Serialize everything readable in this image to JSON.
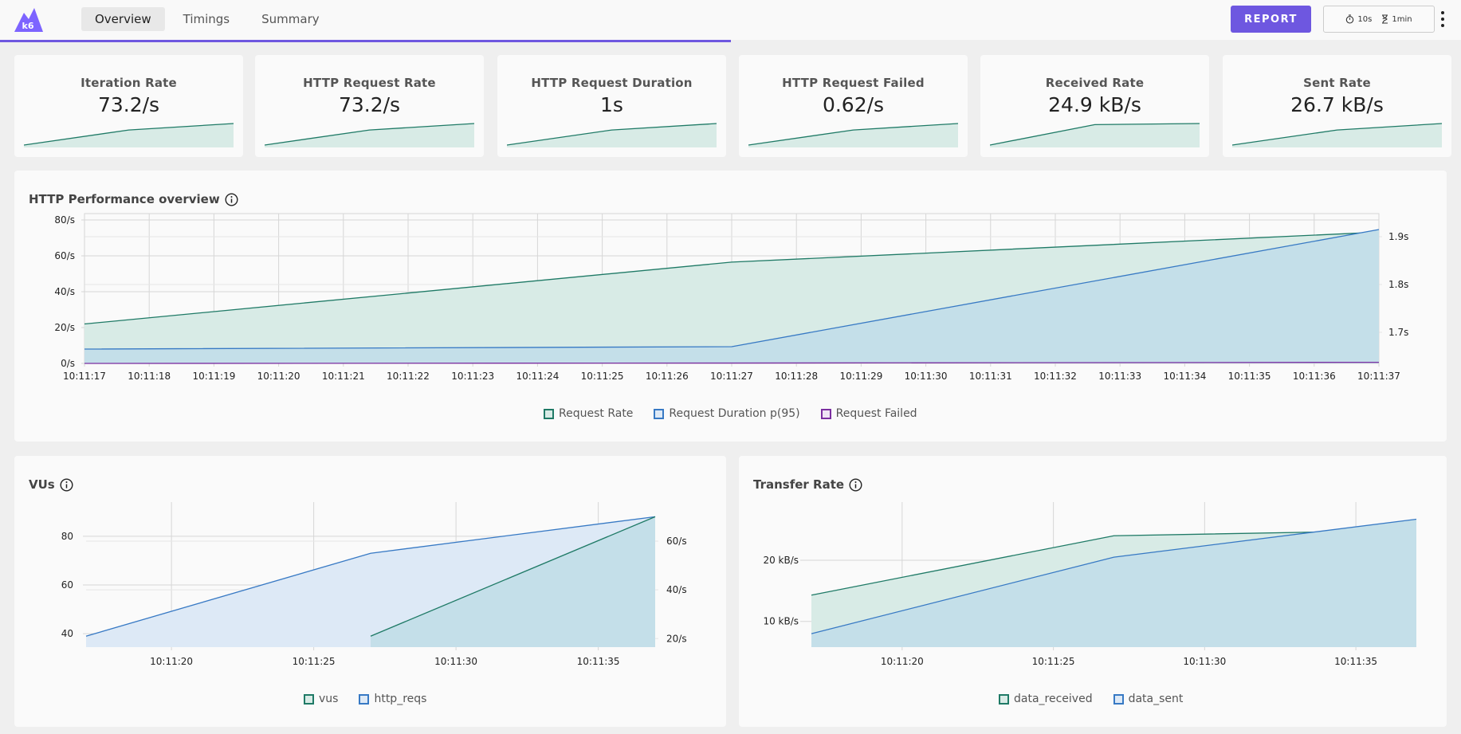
{
  "header": {
    "logo_text": "k6",
    "tabs": [
      {
        "label": "Overview",
        "active": true
      },
      {
        "label": "Timings",
        "active": false
      },
      {
        "label": "Summary",
        "active": false
      }
    ],
    "report_label": "REPORT",
    "refresh_interval": "10s",
    "time_range": "1min",
    "progress": 0.5
  },
  "colors": {
    "accent": "#6e57e0",
    "green": "#1f7a66",
    "green_fill": "#d8ebe6",
    "blue": "#3779c4",
    "blue_fill": "#c4dfe9",
    "blue_fill_light": "#dde9f6",
    "purple": "#7b2fa0"
  },
  "stats": [
    {
      "title": "Iteration Rate",
      "value": "73.2/s",
      "trend": [
        0.0,
        0.7,
        1.0
      ]
    },
    {
      "title": "HTTP Request Rate",
      "value": "73.2/s",
      "trend": [
        0.0,
        0.7,
        1.0
      ]
    },
    {
      "title": "HTTP Request Duration",
      "value": "1s",
      "trend": [
        0.0,
        0.7,
        1.0
      ]
    },
    {
      "title": "HTTP Request Failed",
      "value": "0.62/s",
      "trend": [
        0.0,
        0.7,
        1.0
      ]
    },
    {
      "title": "Received Rate",
      "value": "24.9 kB/s",
      "trend": [
        0.0,
        0.95,
        1.0
      ]
    },
    {
      "title": "Sent Rate",
      "value": "26.7 kB/s",
      "trend": [
        0.0,
        0.7,
        1.0
      ]
    }
  ],
  "http_overview": {
    "title": "HTTP Performance overview",
    "legend": [
      "Request Rate",
      "Request Duration p(95)",
      "Request Failed"
    ],
    "chart_data": {
      "type": "area",
      "x": [
        "10:11:17",
        "10:11:18",
        "10:11:19",
        "10:11:20",
        "10:11:21",
        "10:11:22",
        "10:11:23",
        "10:11:24",
        "10:11:25",
        "10:11:26",
        "10:11:27",
        "10:11:28",
        "10:11:29",
        "10:11:30",
        "10:11:31",
        "10:11:32",
        "10:11:33",
        "10:11:34",
        "10:11:35",
        "10:11:36",
        "10:11:37"
      ],
      "y_left_ticks": [
        "0/s",
        "20/s",
        "40/s",
        "60/s",
        "80/s"
      ],
      "y_left_range": [
        0,
        80
      ],
      "y_right_ticks": [
        "1.7s",
        "1.8s",
        "1.9s"
      ],
      "y_right_range": [
        1.635,
        1.935
      ],
      "grid": true,
      "legend_position": "bottom",
      "series": [
        {
          "name": "Request Rate",
          "axis": "left",
          "points": [
            [
              "10:11:17",
              22
            ],
            [
              "10:11:27",
              56.5
            ],
            [
              "10:11:37",
              73.2
            ]
          ]
        },
        {
          "name": "Request Duration p(95)",
          "axis": "right",
          "points": [
            [
              "10:11:17",
              1.665
            ],
            [
              "10:11:27",
              1.67
            ],
            [
              "10:11:37",
              1.915
            ]
          ]
        },
        {
          "name": "Request Failed",
          "axis": "left",
          "points": [
            [
              "10:11:17",
              0
            ],
            [
              "10:11:27",
              0.2
            ],
            [
              "10:11:37",
              0.62
            ]
          ]
        }
      ]
    }
  },
  "vus_panel": {
    "title": "VUs",
    "legend": [
      "vus",
      "http_reqs"
    ],
    "chart_data": {
      "type": "area",
      "x_ticks": [
        "10:11:20",
        "10:11:25",
        "10:11:30",
        "10:11:35"
      ],
      "x_range": [
        "10:11:17",
        "10:11:37"
      ],
      "y_left_ticks": [
        "40",
        "60",
        "80"
      ],
      "y_left_range": [
        34.5,
        94
      ],
      "y_right_ticks": [
        "20/s",
        "40/s",
        "60/s"
      ],
      "y_right_range": [
        16.5,
        76
      ],
      "grid": true,
      "legend_position": "bottom",
      "series": [
        {
          "name": "vus",
          "axis": "left",
          "points": [
            [
              "10:11:27",
              39
            ],
            [
              "10:11:37",
              88
            ]
          ]
        },
        {
          "name": "http_reqs",
          "axis": "right",
          "points": [
            [
              "10:11:17",
              21
            ],
            [
              "10:11:27",
              55
            ],
            [
              "10:11:37",
              70
            ]
          ]
        }
      ]
    }
  },
  "transfer_panel": {
    "title": "Transfer Rate",
    "legend": [
      "data_received",
      "data_sent"
    ],
    "chart_data": {
      "type": "area",
      "x_ticks": [
        "10:11:20",
        "10:11:25",
        "10:11:30",
        "10:11:35"
      ],
      "x_range": [
        "10:11:17",
        "10:11:37"
      ],
      "y_left_ticks": [
        "10 kB/s",
        "20 kB/s"
      ],
      "y_left_range": [
        5.8,
        29.5
      ],
      "grid": true,
      "legend_position": "bottom",
      "series": [
        {
          "name": "data_received",
          "points": [
            [
              "10:11:17",
              14.3
            ],
            [
              "10:11:27",
              24.0
            ],
            [
              "10:11:37",
              24.9
            ]
          ]
        },
        {
          "name": "data_sent",
          "points": [
            [
              "10:11:17",
              8.0
            ],
            [
              "10:11:27",
              20.5
            ],
            [
              "10:11:37",
              26.7
            ]
          ]
        }
      ]
    }
  }
}
